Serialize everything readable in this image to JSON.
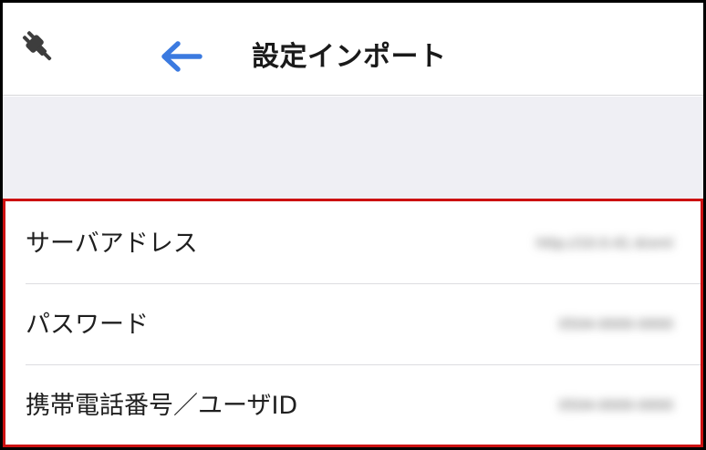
{
  "header": {
    "left_icon": "plug-icon",
    "back_icon": "arrow-left-icon",
    "title": "設定インポート",
    "accent_color": "#3b7ae0"
  },
  "settings": {
    "border_color": "#cc1111",
    "items": [
      {
        "label": "サーバアドレス",
        "value": "http://10.0.41.4/xml"
      },
      {
        "label": "パスワード",
        "value": "0504-0000-0000"
      },
      {
        "label": "携帯電話番号／ユーザID",
        "value": "0504-0000-0000"
      }
    ]
  }
}
